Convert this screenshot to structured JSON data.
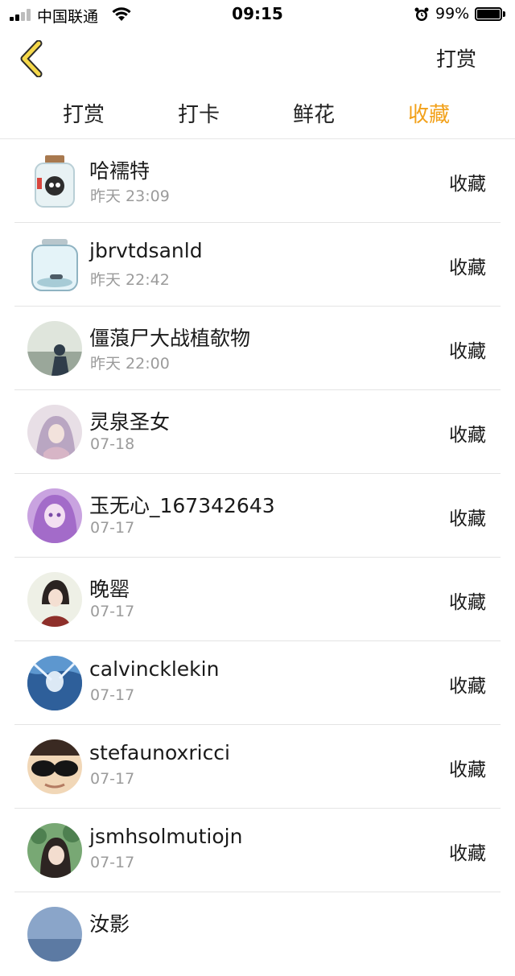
{
  "status_bar": {
    "carrier": "中国联通",
    "time": "09:15",
    "battery": "99%"
  },
  "nav": {
    "back_icon": "chevron-left-icon",
    "action": "打赏",
    "accent": "#f2a11a"
  },
  "tabs": [
    {
      "label": "打赏",
      "active": false
    },
    {
      "label": "打卡",
      "active": false
    },
    {
      "label": "鲜花",
      "active": false
    },
    {
      "label": "收藏",
      "active": true
    }
  ],
  "list": [
    {
      "name": "哈襦特",
      "date": "昨天 23:09",
      "action": "收藏",
      "avatar_color": "#e9dfd0"
    },
    {
      "name": "jbrvtdsanld",
      "date": "昨天 22:42",
      "action": "收藏",
      "avatar_color": "#cfe6ef"
    },
    {
      "name": "僵蒗尸大战植欹物",
      "date": "昨天 22:00",
      "action": "收藏",
      "avatar_color": "#b7c2b4"
    },
    {
      "name": "灵泉圣女",
      "date": "07-18",
      "action": "收藏",
      "avatar_color": "#d9c9d8"
    },
    {
      "name": "玉无心_167342643",
      "date": "07-17",
      "action": "收藏",
      "avatar_color": "#b17bd0"
    },
    {
      "name": "晚罂",
      "date": "07-17",
      "action": "收藏",
      "avatar_color": "#d6cfc2"
    },
    {
      "name": "calvinckleki​n",
      "date": "07-17",
      "action": "收藏",
      "avatar_color": "#4f8cc8"
    },
    {
      "name": "stefaunoxricci",
      "date": "07-17",
      "action": "收藏",
      "avatar_color": "#e5c29a"
    },
    {
      "name": "jsmhsolmutiojn",
      "date": "07-17",
      "action": "收藏",
      "avatar_color": "#6f9a6b"
    },
    {
      "name": "汝影",
      "date": "",
      "action": "",
      "avatar_color": "#8aa5c9"
    }
  ]
}
